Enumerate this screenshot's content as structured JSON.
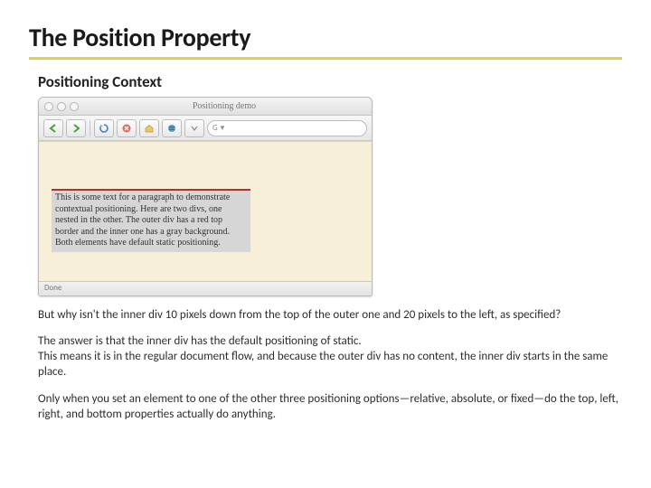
{
  "title": "The Position Property",
  "subtitle": "Positioning Context",
  "browser": {
    "window_title": "Positioning demo",
    "search_prefix": "G",
    "status": "Done",
    "sample_text": "This is some text for a paragraph to demonstrate contextual positioning. Here are two divs, one nested in the other. The outer div has a red top border and the inner one has a gray background. Both elements have default static positioning."
  },
  "para1": "But why isn't the inner div 10 pixels down from the top of the outer one and 20 pixels to the left, as specified?",
  "para2": "The answer is that the inner div has the default positioning of static.\nThis means it is in the regular document flow, and because the outer div has no content, the inner div starts in the same place.",
  "para3": "Only when you set an element to one of the other three positioning options—relative, absolute, or fixed—do the top, left, right, and bottom properties actually do anything."
}
